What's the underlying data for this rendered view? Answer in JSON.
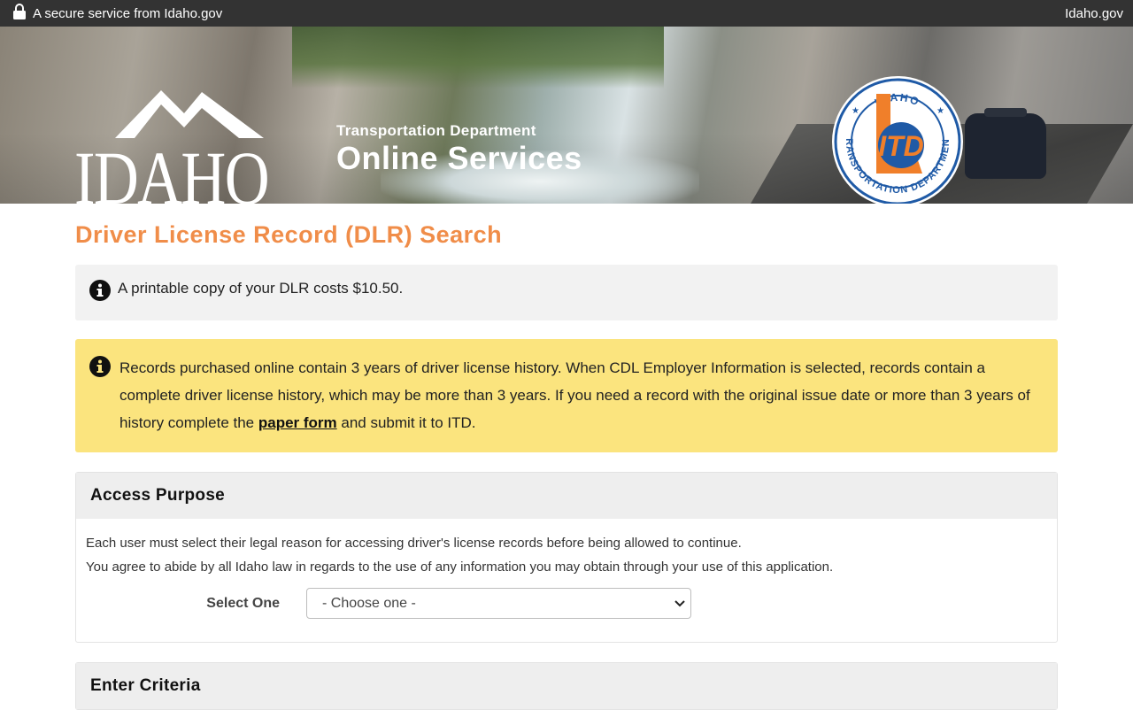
{
  "topbar": {
    "secure_text": "A secure service from Idaho.gov",
    "site_link": "Idaho.gov"
  },
  "banner": {
    "logo_word": "IDAHO",
    "dept_subtitle": "Transportation Department",
    "dept_title": "Online Services",
    "seal_top": "IDAHO",
    "seal_bottom": "TRANSPORTATION DEPARTMENT",
    "seal_letters": "ITD"
  },
  "page": {
    "title": "Driver License Record (DLR) Search"
  },
  "notices": {
    "cost_text": "A printable copy of your DLR costs $10.50.",
    "history_before": "Records purchased online contain 3 years of driver license history. When CDL Employer Information is selected, records contain a complete driver license history, which may be more than 3 years. If you need a record with the original issue date or more than 3 years of history complete the ",
    "history_link": "paper form",
    "history_after": " and submit it to ITD."
  },
  "access_purpose": {
    "heading": "Access Purpose",
    "line1": "Each user must select their legal reason for accessing driver's license records before being allowed to continue.",
    "line2": "You agree to abide by all Idaho law in regards to the use of any information you may obtain through your use of this application.",
    "select_label": "Select One",
    "select_value": "- Choose one -"
  },
  "criteria": {
    "heading": "Enter Criteria"
  },
  "colors": {
    "accent_orange": "#f08d49",
    "topbar": "#333333",
    "notice_yellow": "#fbe47e",
    "notice_gray": "#f2f2f2",
    "seal_blue": "#1f5aa6"
  },
  "icons": {
    "lock": "lock-icon",
    "info": "info-icon",
    "chevron": "chevron-down-icon"
  }
}
